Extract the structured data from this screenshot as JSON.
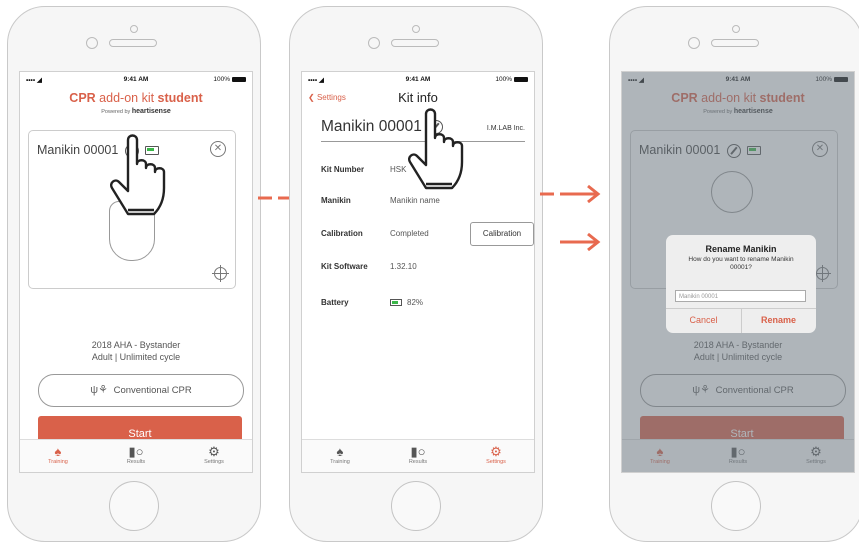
{
  "accent": "#d9614a",
  "status": {
    "time": "9:41 AM",
    "battery": "100%",
    "signal": "•••• ◒"
  },
  "screen1": {
    "title_bold_1": "CPR",
    "title_thin": " add-on kit ",
    "title_bold_2": "student",
    "powered_by": "Powered by ",
    "brand": "heartisense",
    "manikin_name": "Manikin 00001",
    "protocol_line1": "2018 AHA - Bystander",
    "protocol_line2": "Adult | Unlimited cycle",
    "cpr_mode": "Conventional CPR",
    "start": "Start"
  },
  "screen2": {
    "back": "Settings",
    "title": "Kit info",
    "manikin_name": "Manikin 00001",
    "maker": "I.M.LAB Inc.",
    "rows": [
      {
        "label": "Kit Number",
        "value": "HSK"
      },
      {
        "label": "Manikin",
        "value": "Manikin name"
      },
      {
        "label": "Calibration",
        "value": "Completed"
      },
      {
        "label": "Kit Software",
        "value": "1.32.10"
      },
      {
        "label": "Battery",
        "value": "82%"
      }
    ],
    "calibration_button": "Calibration"
  },
  "dialog": {
    "title": "Rename Manikin",
    "message": "How do you want to rename Manikin 00001?",
    "placeholder": "Manikin 00001",
    "cancel": "Cancel",
    "rename": "Rename"
  },
  "tabs": [
    {
      "label": "Training",
      "icon": "training-icon"
    },
    {
      "label": "Results",
      "icon": "results-icon"
    },
    {
      "label": "Settings",
      "icon": "gear-icon"
    }
  ]
}
